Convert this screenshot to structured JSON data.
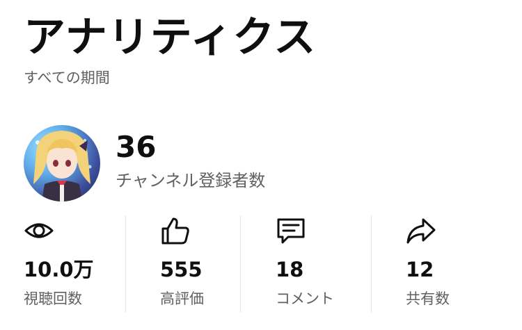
{
  "header": {
    "title": "アナリティクス",
    "period": "すべての期間"
  },
  "channel": {
    "subscriber_count": "36",
    "subscriber_label": "チャンネル登録者数"
  },
  "stats": [
    {
      "icon": "eye-icon",
      "value": "10.0万",
      "label": "視聴回数"
    },
    {
      "icon": "thumbs-up-icon",
      "value": "555",
      "label": "高評価"
    },
    {
      "icon": "comment-icon",
      "value": "18",
      "label": "コメント"
    },
    {
      "icon": "share-icon",
      "value": "12",
      "label": "共有数"
    }
  ]
}
